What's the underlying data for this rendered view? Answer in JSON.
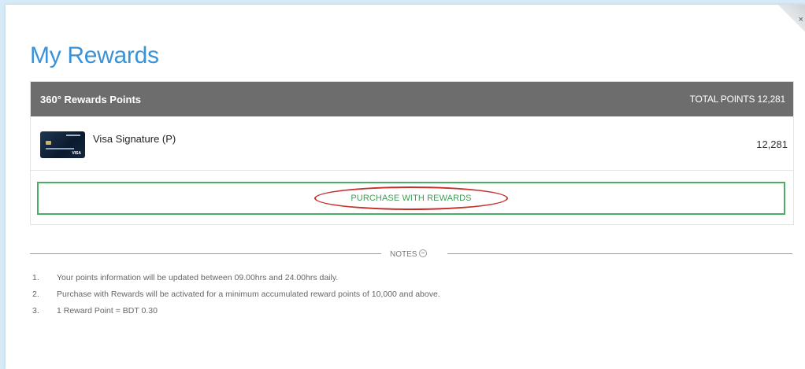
{
  "modal": {
    "close_icon": "close-icon",
    "close_glyph": "×"
  },
  "page": {
    "title": "My Rewards"
  },
  "rewards_panel": {
    "header_title": "360° Rewards Points",
    "total_points_label": "TOTAL POINTS",
    "total_points_value": "12,281",
    "cards": [
      {
        "name": "Visa Signature (P)",
        "points": "12,281",
        "icon": "credit-card-icon",
        "brand": "VISA"
      }
    ],
    "purchase_button_label": "PURCHASE WITH REWARDS",
    "annotation_color": "#c7302b",
    "button_color": "#4cae64"
  },
  "notes": {
    "label": "NOTES",
    "icon": "collapse-circle-icon",
    "items": [
      {
        "num": "1.",
        "text": "Your points information will be updated between 09.00hrs and 24.00hrs daily."
      },
      {
        "num": "2.",
        "text": "Purchase with Rewards will be activated for a minimum accumulated reward points of 10,000 and above."
      },
      {
        "num": "3.",
        "text": "1 Reward Point = BDT 0.30"
      }
    ]
  },
  "colors": {
    "title_blue": "#3a92d8",
    "header_gray": "#6d6d6d",
    "background": "#d6ebf7"
  }
}
